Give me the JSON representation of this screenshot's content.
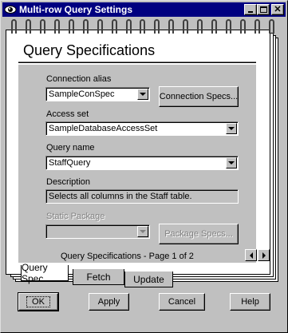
{
  "window": {
    "title": "Multi-row Query Settings"
  },
  "page": {
    "title": "Query Specifications",
    "nav_label": "Query Specifications - Page 1 of 2"
  },
  "fields": {
    "connection_alias": {
      "label": "Connection alias",
      "value": "SampleConSpec"
    },
    "connection_specs_button": "Connection Specs...",
    "access_set": {
      "label": "Access set",
      "value": "SampleDatabaseAccessSet"
    },
    "query_name": {
      "label": "Query name",
      "value": "StaffQuery"
    },
    "description": {
      "label": "Description",
      "value": "Selects all columns in the Staff table."
    },
    "static_package": {
      "label": "Static Package",
      "value": ""
    },
    "package_specs_button": "Package Specs..."
  },
  "tabs": [
    {
      "label": "Query Spec",
      "active": true
    },
    {
      "label": "Fetch",
      "active": false
    },
    {
      "label": "Update",
      "active": false
    }
  ],
  "buttons": {
    "ok": "OK",
    "apply": "Apply",
    "cancel": "Cancel",
    "help": "Help"
  },
  "icons": {
    "app": "eye-icon",
    "minimize": "minimize-icon",
    "maximize": "maximize-icon",
    "close": "close-icon"
  },
  "colors": {
    "titlebar": "#000080",
    "face": "#c0c0c0"
  }
}
